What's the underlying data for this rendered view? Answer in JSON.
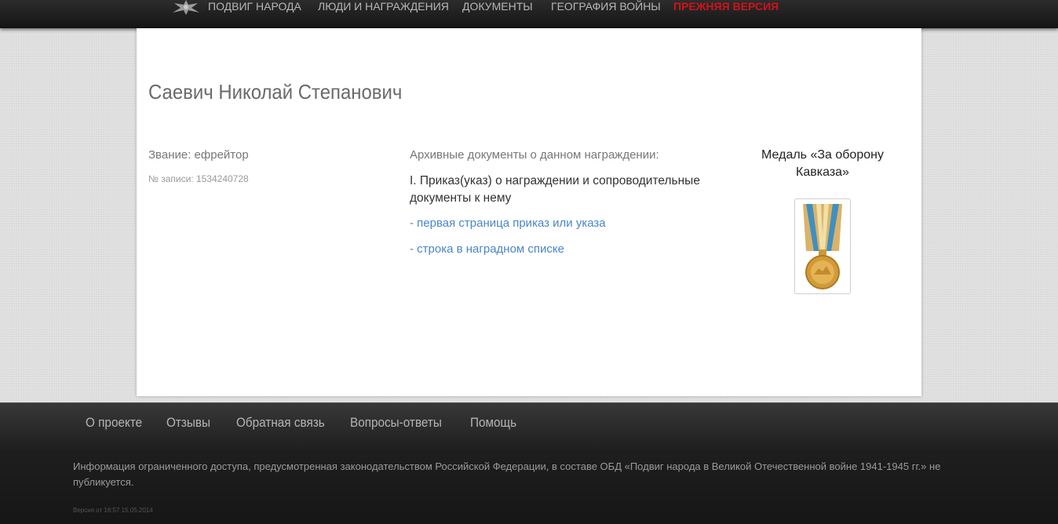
{
  "nav": {
    "items": [
      "ПОДВИГ НАРОДА",
      "ЛЮДИ И НАГРАЖДЕНИЯ",
      "ДОКУМЕНТЫ",
      "ГЕОГРАФИЯ ВОЙНЫ"
    ],
    "legacy": "ПРЕЖНЯЯ ВЕРСИЯ",
    "logo_icon": "eagle-emblem-icon"
  },
  "person": {
    "name": "Саевич Николай Степанович",
    "rank": "Звание: ефрейтор",
    "record": "№ записи: 1534240728"
  },
  "archive": {
    "title": "Архивные документы о данном награждении:",
    "order_title": "I. Приказ(указ) о награждении и сопроводительные документы к нему",
    "links": [
      "- первая страница приказ или указа",
      "- строка в наградном списке"
    ]
  },
  "award": {
    "title": "Медаль «За оборону Кавказа»",
    "image_icon": "medal-icon"
  },
  "footer": {
    "links": [
      "О проекте",
      "Отзывы",
      "Обратная связь",
      "Вопросы-ответы",
      "Помощь"
    ],
    "note": "Информация ограниченного доступа, предусмотренная законодательством Российской Федерации, в составе ОБД «Подвиг народа в Великой Отечественной войне 1941-1945 гг.» не публикуется.",
    "version": "Версия от 16:57 15.05.2014"
  },
  "colors": {
    "legacy_red": "#d0131a",
    "link_blue": "#4a86c6"
  }
}
